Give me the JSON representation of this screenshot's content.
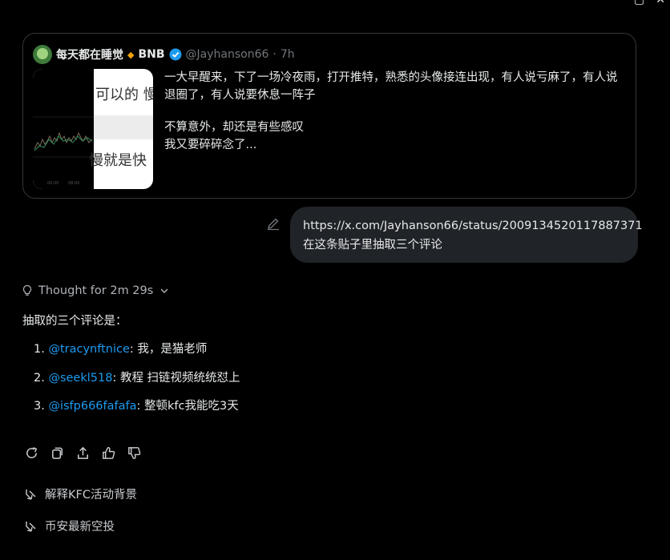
{
  "colors": {
    "background": "#000000",
    "link": "#1d9bf0",
    "bubble": "#202327",
    "border": "#333639",
    "muted": "#71767b"
  },
  "quote": {
    "name": "每天都在睡觉",
    "badge_text": "BNB",
    "handle": "@Jayhanson66",
    "sep": "·",
    "time": "7h",
    "thumb_text_top": "可以的 慢",
    "thumb_text_bottom": "慢就是快",
    "body": {
      "line1": "一大早醒来，下了一场冷夜雨，打开推特，熟悉的头像接连出现，有人说亏麻了，有人说退圈了，有人说要休息一阵子",
      "line2": "不算意外，却还是有些感叹",
      "line3": "我又要碎碎念了..."
    }
  },
  "user_message": {
    "url": "https://x.com/Jayhanson66/status/2009134520117887371",
    "text": "在这条贴子里抽取三个评论"
  },
  "thought_label": "Thought for 2m 29s",
  "answer": {
    "intro": "抽取的三个评论是：",
    "items": [
      {
        "num": "1.",
        "handle": "@tracynftnice",
        "sep": ":",
        "text": "我，是猫老师"
      },
      {
        "num": "2.",
        "handle": "@seekl518",
        "sep": ":",
        "text": "教程 扫链视频统统怼上"
      },
      {
        "num": "3.",
        "handle": "@isfp666fafafa",
        "sep": ":",
        "text": "整顿kfc我能吃3天"
      }
    ]
  },
  "actions": [
    "regenerate-icon",
    "copy-icon",
    "share-icon",
    "thumbs-up-icon",
    "thumbs-down-icon"
  ],
  "suggestions": [
    "解释KFC活动背景",
    "币安最新空投"
  ]
}
